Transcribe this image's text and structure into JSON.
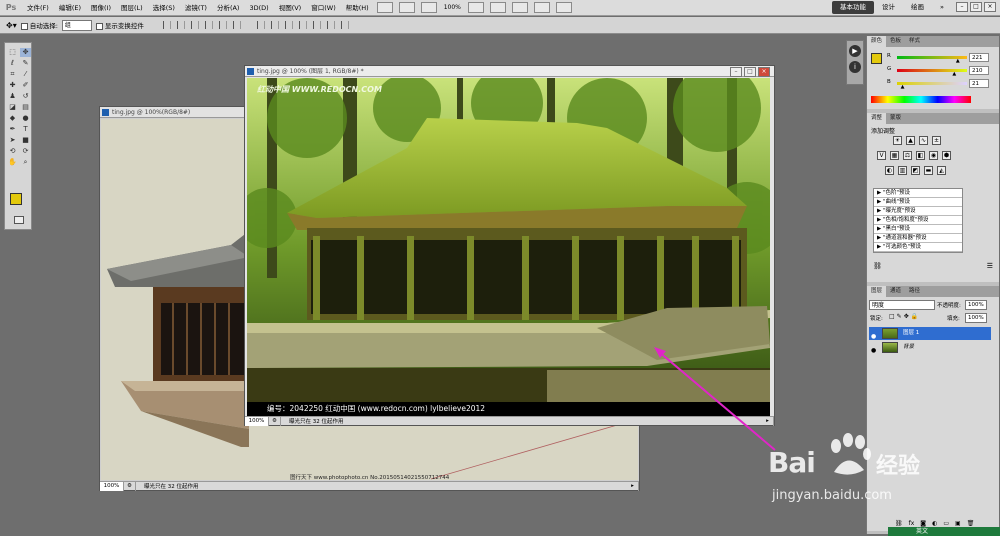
{
  "menubar": {
    "logo": "Ps",
    "items": [
      "文件(F)",
      "编辑(E)",
      "图像(I)",
      "图层(L)",
      "选择(S)",
      "滤镜(T)",
      "分析(A)",
      "3D(D)",
      "视图(V)",
      "窗口(W)",
      "帮助(H)"
    ],
    "zoom": "100%",
    "workspaces": [
      "基本功能",
      "设计",
      "绘画"
    ],
    "more": "»",
    "win_controls": [
      "–",
      "□",
      "×"
    ]
  },
  "options": {
    "auto_select_label": "自动选择:",
    "auto_select_value": "组",
    "show_transform_label": "显示变换控件"
  },
  "docs": {
    "back": {
      "title": "ting.jpg @ 100%(RGB/8#)",
      "zoom": "100%",
      "status": "曝光只在 32 位起作用",
      "caption": "图行天下 www.photophoto.cn  No.20150514021550712744"
    },
    "front": {
      "title": "ting.jpg @ 100% (图层 1, RGB/8#) *",
      "watermark": "红动中国 WWW.REDOCN.COM",
      "footer": "编号：2042250    红动中国 (www.redocn.com)    lylbelieve2012",
      "zoom": "100%",
      "status": "曝光只在 32 位起作用"
    }
  },
  "color_panel": {
    "tabs": [
      "颜色",
      "色板",
      "样式"
    ],
    "channels": [
      {
        "label": "R",
        "value": "221",
        "frac": 0.87,
        "grad": "linear-gradient(90deg,#00b915,#ffb915)"
      },
      {
        "label": "G",
        "value": "210",
        "frac": 0.82,
        "grad": "linear-gradient(90deg,#dd0015,#ddff15)"
      },
      {
        "label": "B",
        "value": "21",
        "frac": 0.08,
        "grad": "linear-gradient(90deg,#ddd200,#ddd2ff)"
      }
    ]
  },
  "adjust_panel": {
    "tabs": [
      "调整",
      "蒙版"
    ],
    "heading": "添加调整",
    "presets": [
      "\"色阶\"预设",
      "\"曲线\"预设",
      "\"曝光度\"预设",
      "\"色相/饱和度\"预设",
      "\"黑白\"预设",
      "\"通道混和器\"预设",
      "\"可选颜色\"预设"
    ]
  },
  "layers_panel": {
    "tabs": [
      "图层",
      "通道",
      "路径"
    ],
    "blend_mode": "明度",
    "opacity_label": "不透明度:",
    "opacity": "100%",
    "lock_label": "锁定:",
    "fill_label": "填充:",
    "fill": "100%",
    "layers": [
      {
        "name": "图层 1",
        "selected": true
      },
      {
        "name": "背景",
        "selected": false
      }
    ]
  },
  "ime": "英文",
  "baidu": {
    "logo": "Bai",
    "logo_cn": "经验",
    "url": "jingyan.baidu.com"
  }
}
